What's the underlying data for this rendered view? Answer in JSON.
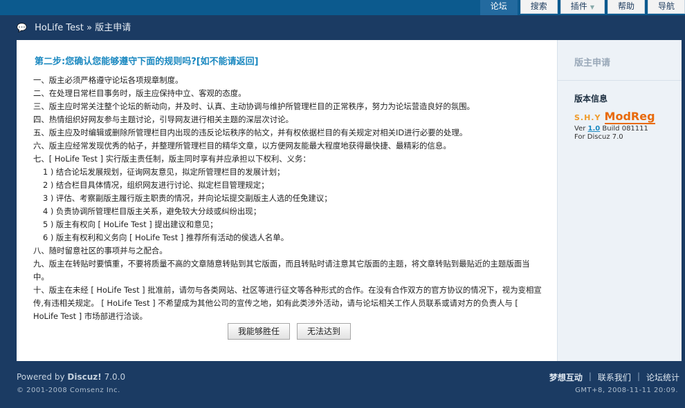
{
  "nav": {
    "tabs": [
      {
        "label": "论坛",
        "active": true
      },
      {
        "label": "搜索",
        "active": false
      },
      {
        "label": "插件",
        "active": false,
        "has_dropdown": true
      },
      {
        "label": "帮助",
        "active": false
      },
      {
        "label": "导航",
        "active": false
      }
    ]
  },
  "breadcrumb": {
    "site": "HoLife Test",
    "separator": "»",
    "page": "版主申请"
  },
  "main": {
    "heading": "第二步:您确认您能够遵守下面的规则吗?[如不能请返回]",
    "rules": [
      "一、版主必须严格遵守论坛各项规章制度。",
      "二、在处理日常栏目事务时，版主应保持中立、客观的态度。",
      "三、版主应时常关注整个论坛的新动向，并及时、认真、主动协调与维护所管理栏目的正常秩序，努力为论坛营造良好的氛围。",
      "四、热情组织好网友参与主题讨论，引导网友进行相关主题的深层次讨论。",
      "五、版主应及时编辑或删除所管理栏目内出现的违反论坛秩序的帖文，并有权依据栏目的有关规定对相关ID进行必要的处理。",
      "六、版主应经常发现优秀的帖子，并整理所管理栏目的精华文章，以方便网友能最大程度地获得最快捷、最精彩的信息。",
      "七、[ HoLife Test ] 实行版主责任制，版主同时享有并应承担以下权利、义务：",
      "1 ) 结合论坛发展规划，征询网友意见，拟定所管理栏目的发展计划；",
      "2 ) 结合栏目具体情况，组织网友进行讨论、拟定栏目管理规定；",
      "3 ) 评估、考察副版主履行版主职责的情况，并向论坛提交副版主人选的任免建议；",
      "4 ) 负责协调所管理栏目版主关系，避免较大分歧或纠纷出现；",
      "5 ) 版主有权向 [ HoLife Test ] 提出建议和意见；",
      "6 ) 版主有权利和义务向 [ HoLife Test ] 推荐所有活动的侯选人名单。",
      "八、随时留意社区的事项并与之配合。",
      "九、版主在转贴时要慎重，不要将质量不高的文章随意转贴到其它版面，而且转贴时请注意其它版面的主题，将文章转贴到最贴近的主题版面当中。",
      "十、版主在未经 [ HoLife Test ] 批准前，请勿与各类网站、社区等进行征文等各种形式的合作。在没有合作双方的官方协议的情况下，视为变相宣传,有违相关规定。 [ HoLife Test ] 不希望成为其他公司的宣传之地，如有此类涉外活动，请与论坛相关工作人员联系或请对方的负责人与 [ HoLife Test ] 市场部进行洽谈。"
    ],
    "sub_rule_indices": [
      7,
      8,
      9,
      10,
      11,
      12
    ],
    "accept_label": "我能够胜任",
    "reject_label": "无法达到"
  },
  "side": {
    "title": "版主申请",
    "info_label": "版本信息",
    "logo_prefix": "S.H.Y",
    "logo_name": "ModReg",
    "version_prefix": "Ver",
    "version": "1.0",
    "build": "Build 081111",
    "for_text": "For Discuz 7.0"
  },
  "footer": {
    "powered_prefix": "Powered by",
    "powered_brand": "Discuz!",
    "powered_version": "7.0.0",
    "copyright": "© 2001-2008 Comsenz Inc.",
    "links": [
      "梦想互动",
      "联系我们",
      "论坛统计"
    ],
    "gmt": "GMT+8, 2008-11-11 20:09."
  }
}
